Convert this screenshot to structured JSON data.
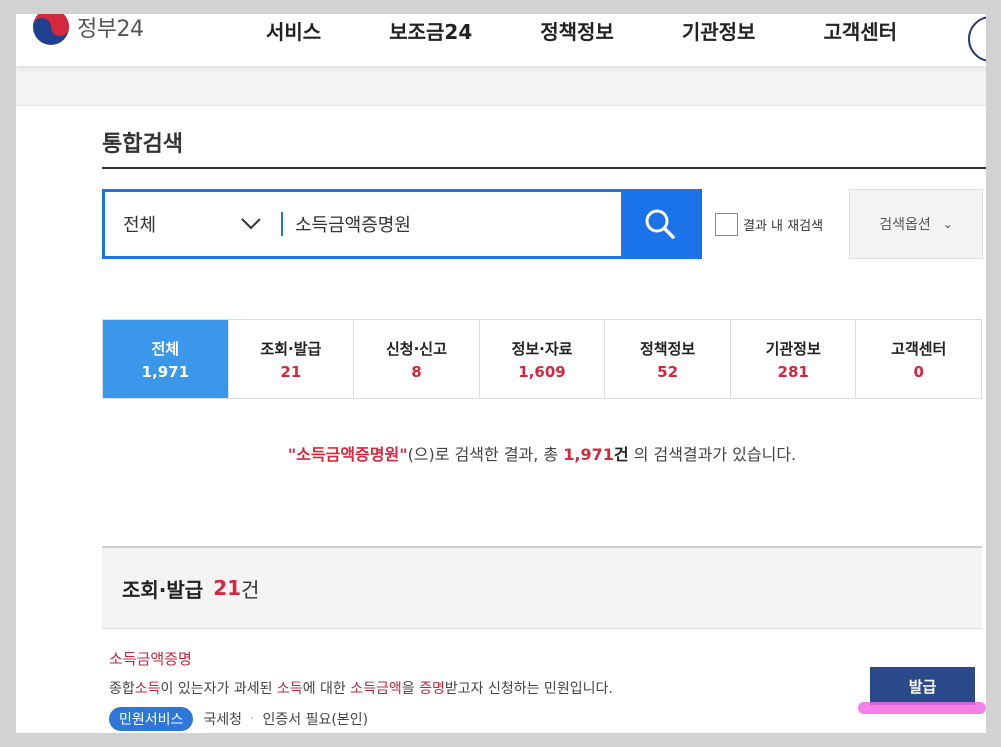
{
  "brand": {
    "name": "정부24"
  },
  "nav": [
    "서비스",
    "보조금24",
    "정책정보",
    "기관정보",
    "고객센터"
  ],
  "page": {
    "title": "통합검색"
  },
  "search": {
    "scope": "전체",
    "query": "소득금액증명원",
    "recheck_label": "결과 내 재검색",
    "options_label": "검색옵션"
  },
  "tabs": [
    {
      "label": "전체",
      "count": "1,971"
    },
    {
      "label": "조회·발급",
      "count": "21"
    },
    {
      "label": "신청·신고",
      "count": "8"
    },
    {
      "label": "정보·자료",
      "count": "1,609"
    },
    {
      "label": "정책정보",
      "count": "52"
    },
    {
      "label": "기관정보",
      "count": "281"
    },
    {
      "label": "고객센터",
      "count": "0"
    }
  ],
  "summary": {
    "keyword": "\"소득금액증명원\"",
    "text1": "(으)로 검색한 결과, 총",
    "total": "1,971",
    "unit": "건",
    "text2": "의 검색결과가 있습니다."
  },
  "section": {
    "label": "조회·발급",
    "count": "21",
    "unit": "건"
  },
  "result": {
    "title": "소득금액증명",
    "desc": [
      "종합",
      "소득",
      "이 있는자가 과세된 ",
      "소득",
      "에 대한 ",
      "소득금액",
      "을 ",
      "증명",
      "받고자 신청하는 민원입니다."
    ],
    "badge": "민원서비스",
    "agency": "국세청",
    "requirement": "인증서 필요(본인)",
    "button": "발급"
  },
  "colors": {
    "accent": "#1a73e8",
    "active_tab": "#3b97ea",
    "highlight": "#d6283c",
    "button": "#2a4a8a"
  }
}
